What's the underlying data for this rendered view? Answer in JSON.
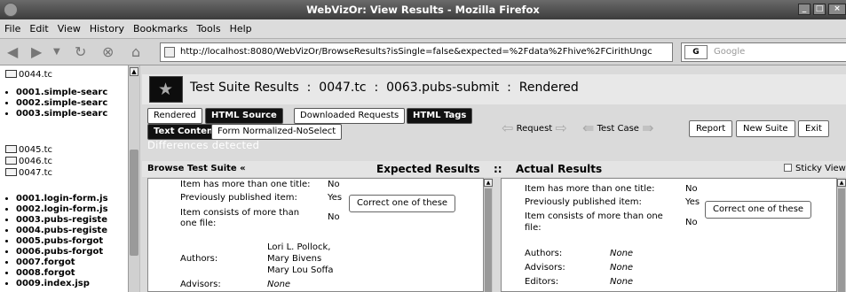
{
  "window": {
    "title": "WebVizOr: View Results - Mozilla Firefox"
  },
  "menu": [
    "File",
    "Edit",
    "View",
    "History",
    "Bookmarks",
    "Tools",
    "Help"
  ],
  "nav": {
    "url": "http://localhost:8080/WebVizOr/BrowseResults?isSingle=false&expected=%2Fdata%2Fhive%2FCirithUngc",
    "search_engine": "G",
    "search_placeholder": "Google"
  },
  "sidebar": {
    "folder1": "0044.tc",
    "items1": [
      "0001.simple-searc",
      "0002.simple-searc",
      "0003.simple-searc"
    ],
    "folder2": "0045.tc",
    "folder3": "0046.tc",
    "folder4": "0047.tc",
    "items2": [
      "0001.login-form.js",
      "0002.login-form.js",
      "0003.pubs-registe",
      "0004.pubs-registe",
      "0005.pubs-forgot",
      "0006.pubs-forgot",
      "0007.forgot",
      "0008.forgot",
      "0009.index.jsp"
    ]
  },
  "header": {
    "title": "Test Suite Results  :  0047.tc  :  0063.pubs-submit  :  Rendered"
  },
  "toolbar": {
    "rendered": "Rendered",
    "html_source": "HTML Source",
    "downloaded": "Downloaded Requests",
    "html_tags": "HTML Tags",
    "text_content": "Text Content",
    "form_normalized": "Form Normalized-NoSelect",
    "differences": "Differences detected",
    "request": "Request",
    "test_case": "Test Case",
    "report": "Report",
    "new_suite": "New Suite",
    "exit": "Exit"
  },
  "columns": {
    "browse": "Browse Test Suite «",
    "expected": "Expected Results",
    "separator": "::",
    "actual": "Actual Results",
    "sticky": "Sticky View"
  },
  "expected": {
    "row1_label": "Item has more than one title:",
    "row1_value": "No",
    "row2_label": "Previously published item:",
    "row2_value": "Yes",
    "row2_button": "Correct one of these",
    "row3_label_a": "Item consists of more than",
    "row3_label_b": "one file:",
    "row3_value": "No",
    "authors_label": "Authors:",
    "authors": [
      "Lori L. Pollock,",
      "Mary Bivens",
      "Mary Lou Soffa"
    ],
    "advisors_label": "Advisors:",
    "advisors_value": "None"
  },
  "actual": {
    "row1_label": "Item has more than one title:",
    "row1_value": "No",
    "row2_label": "Previously published item:",
    "row2_value": "Yes",
    "row2_button": "Correct one of these",
    "row3_label_a": "Item consists of more than one",
    "row3_label_b": "file:",
    "row3_value": "No",
    "authors_label": "Authors:",
    "authors_value": "None",
    "advisors_label": "Advisors:",
    "advisors_value": "None",
    "editors_label": "Editors:",
    "editors_value": "None"
  }
}
